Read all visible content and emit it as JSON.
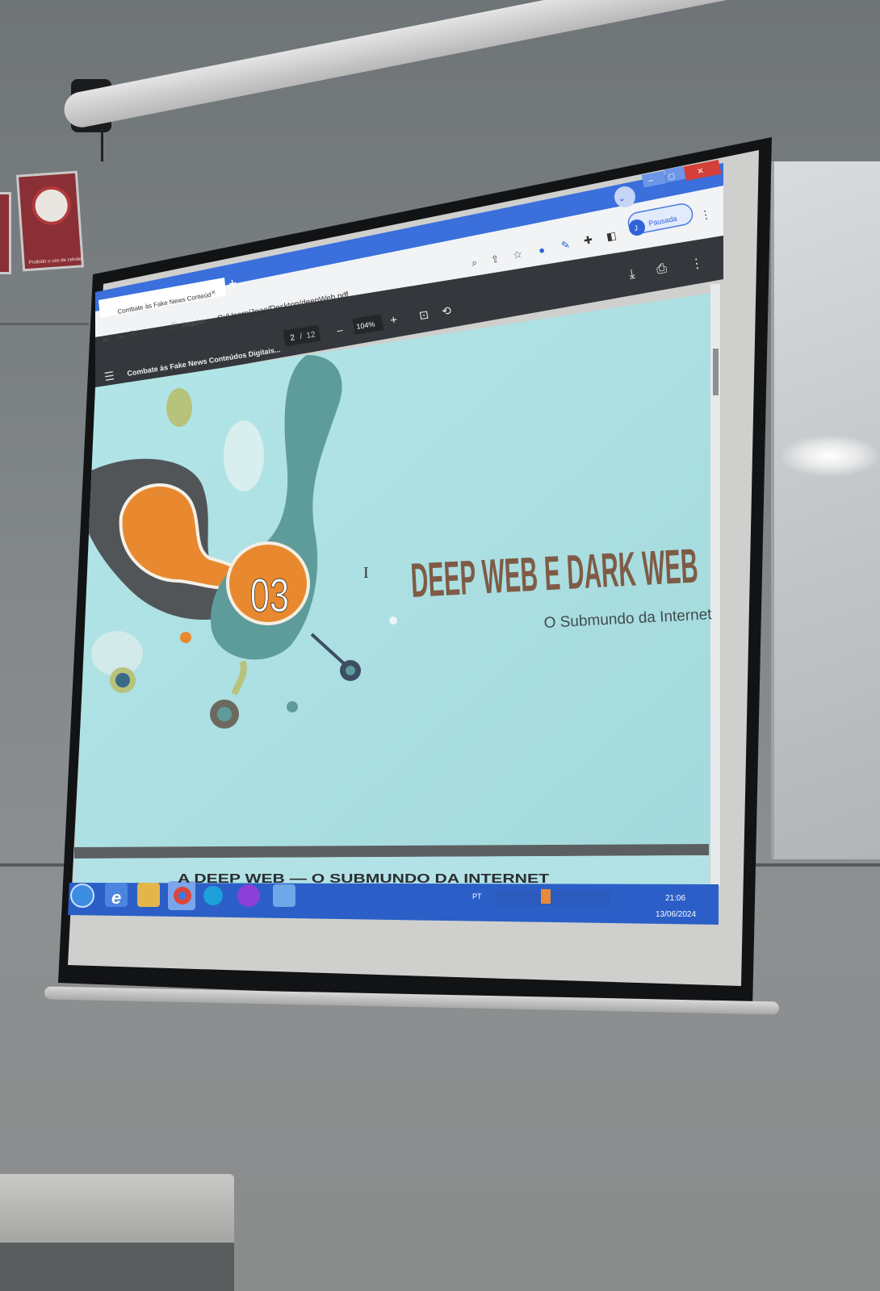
{
  "browser": {
    "tab_title": "Combate às Fake News Conteúd",
    "new_tab": "+",
    "url_secure_label": "Arquivo",
    "url": "C:/Users/Joao/Desktop/deepWeb.pdf",
    "profile_initial": "J",
    "profile_label": "Pausada",
    "window_min": "–",
    "window_max": "▢",
    "window_close": "✕"
  },
  "pdf_toolbar": {
    "doc_title": "Combate às Fake News Conteúdos Digitais...",
    "page_current": "2",
    "page_separator": "/",
    "page_total": "12",
    "zoom_out": "–",
    "zoom": "104%",
    "zoom_in": "+"
  },
  "slide": {
    "number": "03",
    "title": "DEEP WEB E DARK WEB",
    "subtitle": "O Submundo da Internet",
    "cursor": "I",
    "next_title_partial": "A DEEP WEB — O SUBMUNDO DA INTERNET"
  },
  "taskbar": {
    "language": "PT",
    "time": "21:06",
    "date": "13/06/2024",
    "apps": [
      "start-orb",
      "internet-explorer",
      "file-explorer",
      "chrome",
      "edge",
      "firefox",
      "generic-app"
    ]
  },
  "room": {
    "sign_text": "Proibido o uso de celular"
  },
  "colors": {
    "slide_bg": "#aee0e3",
    "teal": "#5d9c9a",
    "orange": "#e8892f",
    "dark_gray": "#525558",
    "olive": "#b7c27a",
    "title_brown": "#7f5b46",
    "browser_blue": "#2f63d7",
    "taskbar_blue": "#2b5fc7"
  }
}
